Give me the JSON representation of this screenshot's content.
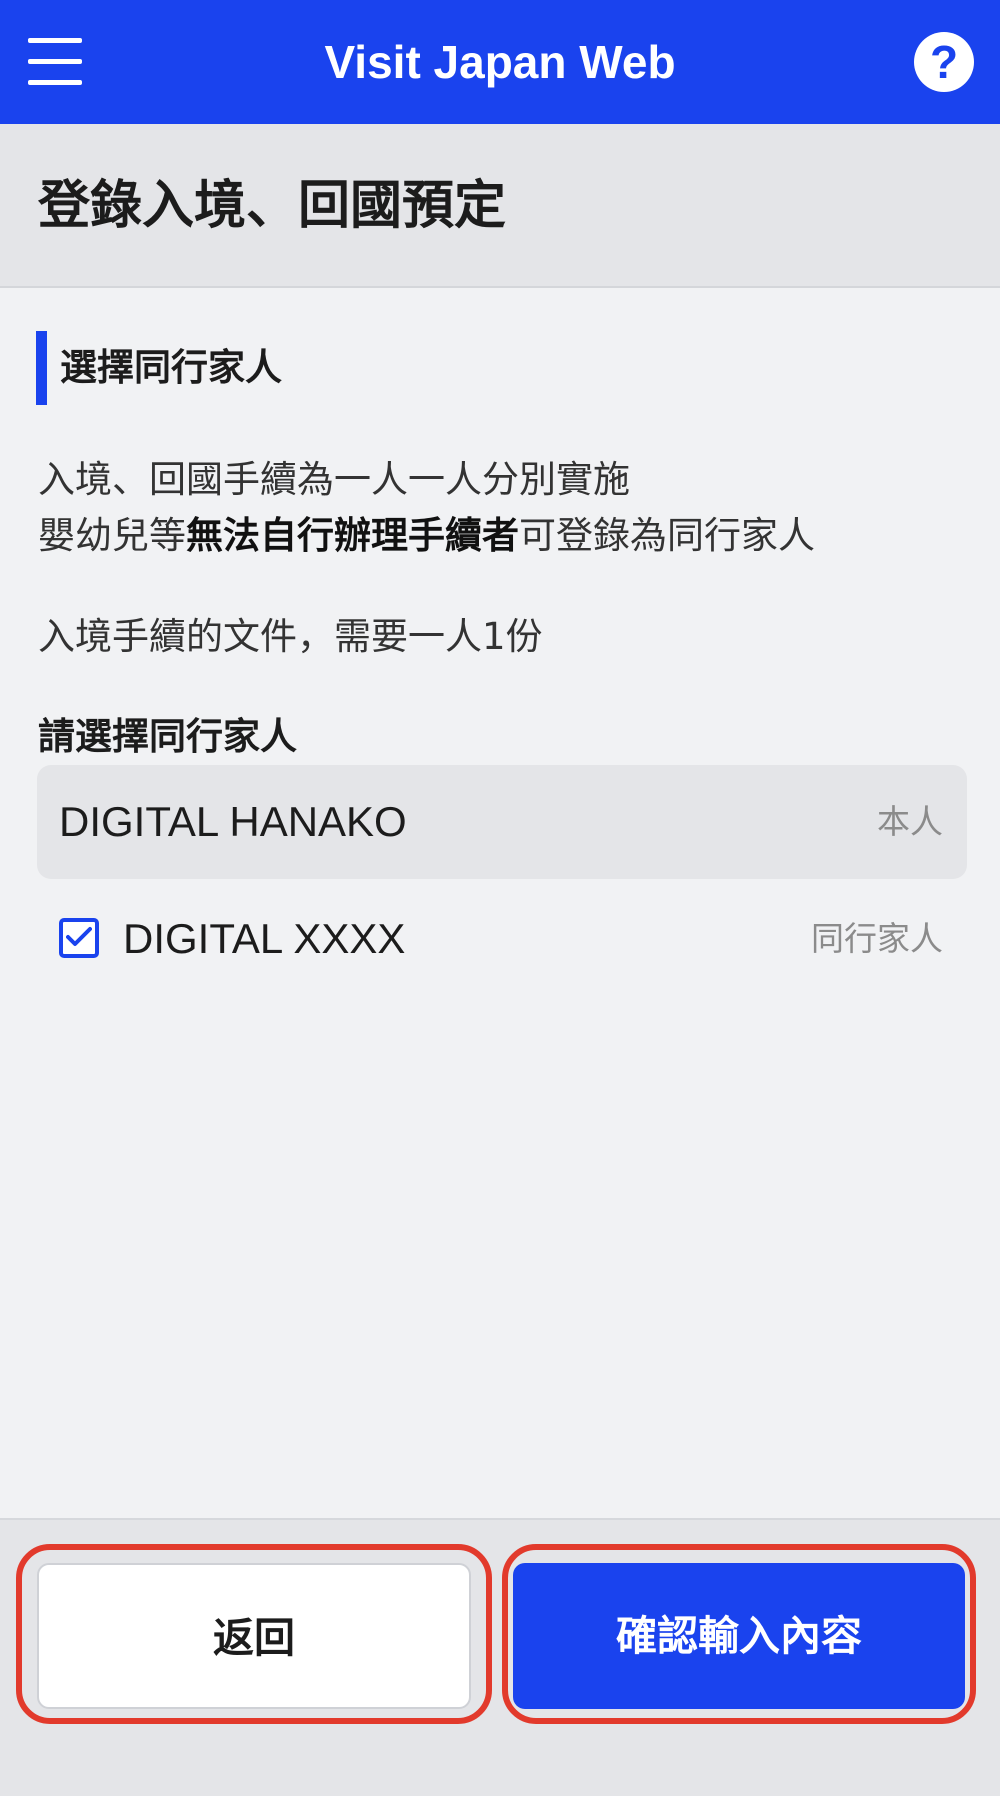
{
  "header": {
    "title": "Visit Japan Web",
    "menu_icon": "hamburger-menu-icon",
    "help_icon": "question-mark-icon",
    "help_glyph": "?"
  },
  "page": {
    "title": "登錄入境、回國預定"
  },
  "section": {
    "title": "選擇同行家人",
    "line1": "入境、回國手續為一人一人分別實施",
    "line2_prefix": "嬰幼兒等",
    "line2_bold": "無法自行辦理手續者",
    "line2_suffix": "可登錄為同行家人",
    "line3": "入境手續的文件，需要一人1份"
  },
  "family": {
    "label": "請選擇同行家人",
    "self": {
      "name": "DIGITAL HANAKO",
      "tag": "本人"
    },
    "members": [
      {
        "name": "DIGITAL XXXX",
        "tag": "同行家人",
        "checked": true
      }
    ]
  },
  "footer": {
    "back_label": "返回",
    "confirm_label": "確認輸入內容"
  },
  "colors": {
    "primary": "#1a43ee",
    "highlight": "#e23a2c",
    "background": "#f1f2f4"
  }
}
